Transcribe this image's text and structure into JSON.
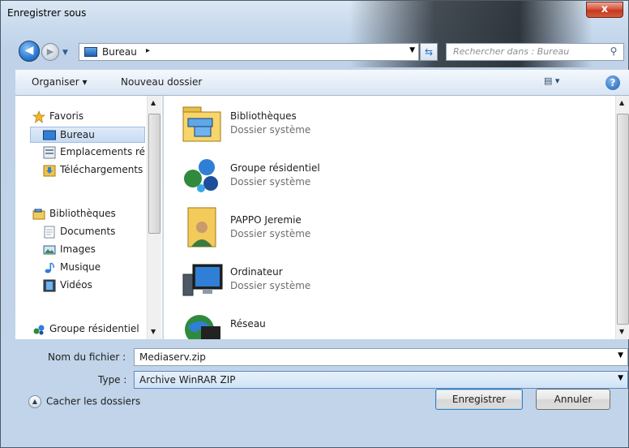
{
  "window": {
    "title": "Enregistrer sous",
    "close_label": "x"
  },
  "nav": {
    "address_location": "Bureau",
    "address_separator": "▸",
    "search_placeholder": "Rechercher dans : Bureau"
  },
  "toolbar": {
    "organiser": "Organiser ▾",
    "new_folder": "Nouveau dossier",
    "views": "▤ ▾",
    "help": "?"
  },
  "sidebar": {
    "items": [
      {
        "label": "Favoris",
        "icon": "star-icon"
      },
      {
        "label": "Bureau",
        "icon": "desktop-icon"
      },
      {
        "label": "Emplacements ré",
        "icon": "recent-places-icon"
      },
      {
        "label": "Téléchargements",
        "icon": "downloads-icon"
      },
      {
        "label": "Bibliothèques",
        "icon": "libraries-icon"
      },
      {
        "label": "Documents",
        "icon": "documents-icon"
      },
      {
        "label": "Images",
        "icon": "pictures-icon"
      },
      {
        "label": "Musique",
        "icon": "music-icon"
      },
      {
        "label": "Vidéos",
        "icon": "videos-icon"
      },
      {
        "label": "Groupe résidentiel",
        "icon": "homegroup-icon"
      }
    ]
  },
  "files": [
    {
      "name": "Bibliothèques",
      "type": "Dossier système",
      "icon": "libraries-folder-icon"
    },
    {
      "name": "Groupe résidentiel",
      "type": "Dossier système",
      "icon": "homegroup-icon"
    },
    {
      "name": "PAPPO Jeremie",
      "type": "Dossier système",
      "icon": "user-folder-icon"
    },
    {
      "name": "Ordinateur",
      "type": "Dossier système",
      "icon": "computer-icon"
    },
    {
      "name": "Réseau",
      "type": "",
      "icon": "network-icon"
    }
  ],
  "form": {
    "filename_label": "Nom du fichier :",
    "filename_value": "Mediaserv.zip",
    "type_label": "Type :",
    "type_value": "Archive WinRAR ZIP"
  },
  "footer": {
    "hide_folders": "Cacher les dossiers",
    "save": "Enregistrer",
    "cancel": "Annuler"
  },
  "colors": {
    "selection": "#c7dbf3",
    "accent": "#1f5fb0"
  }
}
